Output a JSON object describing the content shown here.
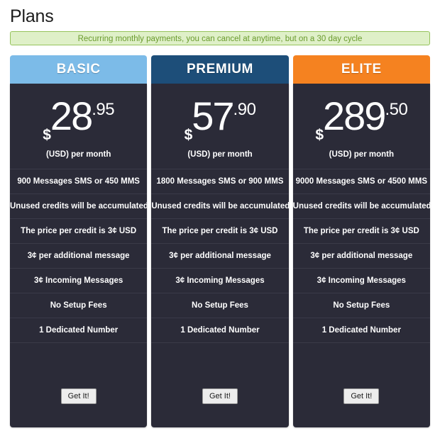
{
  "page": {
    "title": "Plans",
    "notice": "Recurring monthly payments, you can cancel at anytime, but on a 30 day cycle"
  },
  "colors": {
    "basic_header": "#7cbbe8",
    "premium_header": "#1d4e79",
    "elite_header": "#f58220",
    "card_background": "#2b2b38",
    "notice_background": "#dff0c8",
    "notice_border": "#95c35b",
    "notice_text": "#6a9b2e"
  },
  "plans": [
    {
      "name": "BASIC",
      "currency": "$",
      "amount": "28",
      "cents": ".95",
      "caption": "(USD) per month",
      "features": [
        "900 Messages SMS or 450 MMS",
        "Unused credits will be accumulated",
        "The price per credit is 3¢ USD",
        "3¢ per additional message",
        "3¢ Incoming Messages",
        "No Setup Fees",
        "1 Dedicated Number"
      ],
      "cta": "Get It!"
    },
    {
      "name": "PREMIUM",
      "currency": "$",
      "amount": "57",
      "cents": ".90",
      "caption": "(USD) per month",
      "features": [
        "1800 Messages SMS or 900 MMS",
        "Unused credits will be accumulated",
        "The price per credit is 3¢ USD",
        "3¢ per additional message",
        "3¢ Incoming Messages",
        "No Setup Fees",
        "1 Dedicated Number"
      ],
      "cta": "Get It!"
    },
    {
      "name": "ELITE",
      "currency": "$",
      "amount": "289",
      "cents": ".50",
      "caption": "(USD) per month",
      "features": [
        "9000 Messages SMS or 4500 MMS",
        "Unused credits will be accumulated",
        "The price per credit is 3¢ USD",
        "3¢ per additional message",
        "3¢ Incoming Messages",
        "No Setup Fees",
        "1 Dedicated Number"
      ],
      "cta": "Get It!"
    }
  ]
}
